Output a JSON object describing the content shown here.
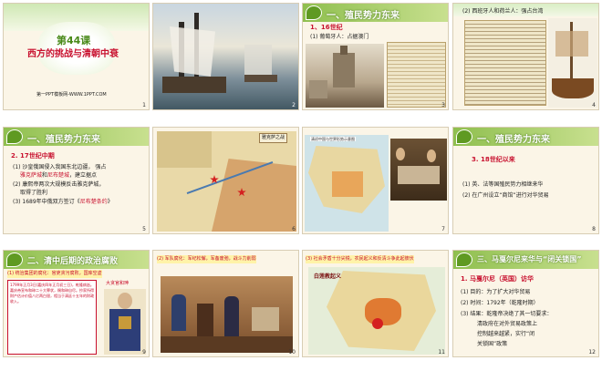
{
  "s1": {
    "lesson": "第44课",
    "title": "西方的挑战与清朝中衰",
    "footer": "第一PPT模板网-WWW.1PPT.COM",
    "num": "1"
  },
  "s2": {
    "num": "2"
  },
  "s3": {
    "header": "一、殖民势力东来",
    "sub1": "1、16世纪",
    "sub2": "(1) 葡萄牙人：占据澳门",
    "num": "3"
  },
  "s4": {
    "sub": "(2) 西班牙人和荷兰人：强占台湾",
    "num": "4"
  },
  "s5": {
    "header": "一、殖民势力东来",
    "h": "2. 17世纪中期",
    "l1": "(1) 沙皇俄国侵入我国东北边疆，",
    "l1b": "强占",
    "l2a": "雅克萨城",
    "l2b": "和",
    "l2c": "尼布楚城",
    "l2d": "，建立据点",
    "l3": "(2) 康熙帝两次大规模反击雅克萨城，",
    "l3b": "取得了胜利",
    "l4a": "(3) 1689年中俄双方签订《",
    "l4b": "尼布楚条约",
    "l4c": "》",
    "num": "5"
  },
  "s6": {
    "tag": "雅克萨之战",
    "num": "6"
  },
  "s7": {
    "title": "清初中国与世界形势示意图",
    "num": "7"
  },
  "s8": {
    "header": "一、殖民势力东来",
    "h": "3. 18世纪以来",
    "l1": "(1) 英、法等国殖民势力相继来华",
    "l2": "(2) 在广州设立“商馆”进行对华贸易",
    "num": "8"
  },
  "s9": {
    "header": "二、清中后期的政治腐败",
    "sub": "(1) 统治集团的腐化：官吏贪污腐败，国库空虚",
    "box": "1799年正月3日(嘉庆四年正月初三日)，乾隆病逝。嘉庆帝宣布和珅二十大罪状，赐和珅自尽。抄家所得财产估计价值八亿两白银，相当于清廷十五年的财政收入。",
    "label": "大贪官和珅",
    "num": "9"
  },
  "s10": {
    "sub": "(2) 军队腐化：军纪松懈，军备废弛，战斗力削弱",
    "num": "10"
  },
  "s11": {
    "sub": "(3) 社会矛盾十分尖锐，农民起义和反清斗争此起彼伏",
    "map": "白莲教起义",
    "num": "11"
  },
  "s12": {
    "header": "三、马戛尔尼来华与“闭关锁国”",
    "h": "1. 马戛尔尼（英国）访华",
    "l1": "(1) 目的：为了扩大对华贸易",
    "l2": "(2) 时间：1792年（乾隆时期）",
    "l3": "(3) 结果：乾隆帝决绝了其一切要求：",
    "l4": "清政府在对外贸易政策上",
    "l5": "控制越来越紧，实行“闭",
    "l6": "关锁国”政策",
    "num": "12"
  }
}
